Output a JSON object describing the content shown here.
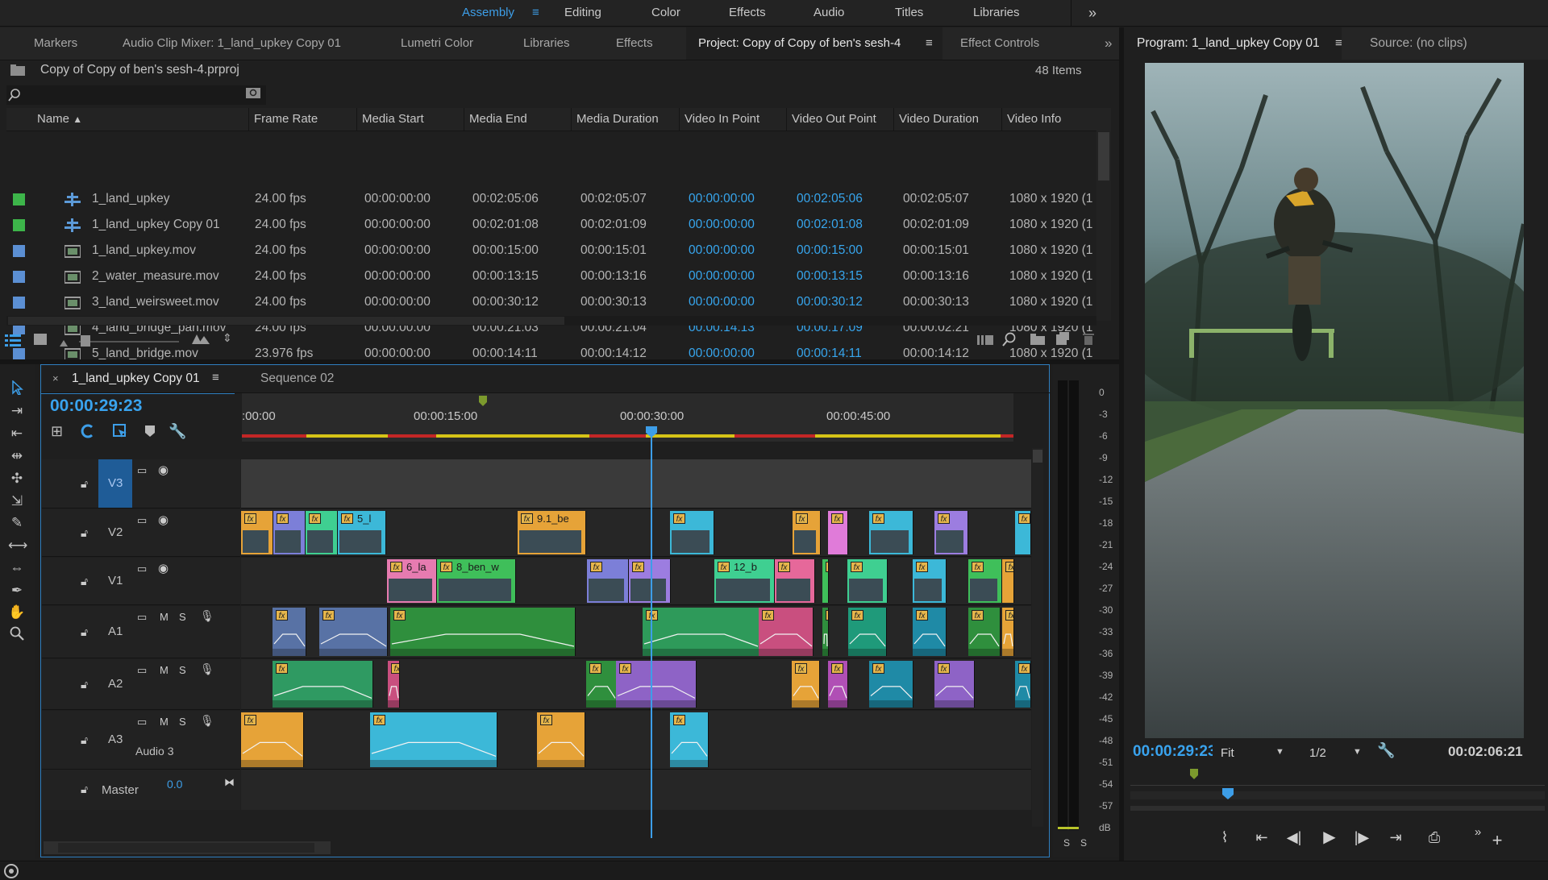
{
  "workspaces": {
    "items": [
      "Assembly",
      "Editing",
      "Color",
      "Effects",
      "Audio",
      "Titles",
      "Libraries"
    ],
    "active": "Assembly",
    "more": "»"
  },
  "panel_tabs": {
    "markers": "Markers",
    "audio_clip_mixer": "Audio Clip Mixer: 1_land_upkey Copy 01",
    "lumetri": "Lumetri Color",
    "libraries": "Libraries",
    "effects": "Effects",
    "project": "Project: Copy of Copy of ben's sesh-4",
    "effect_controls": "Effect Controls",
    "more": "»"
  },
  "project": {
    "filename": "Copy of Copy of ben's sesh-4.prproj",
    "item_count": "48 Items",
    "columns": [
      "Name",
      "Frame Rate",
      "Media Start",
      "Media End",
      "Media Duration",
      "Video In Point",
      "Video Out Point",
      "Video Duration",
      "Video Info"
    ],
    "rows": [
      {
        "color": "#3db54a",
        "kind": "sequence",
        "name": "1_land_upkey",
        "fps": "24.00 fps",
        "start": "00:00:00:00",
        "end": "00:02:05:06",
        "dur": "00:02:05:07",
        "vin": "00:00:00:00",
        "vout": "00:02:05:06",
        "vdur": "00:02:05:07",
        "info": "1080 x 1920 (1"
      },
      {
        "color": "#3db54a",
        "kind": "sequence",
        "name": "1_land_upkey Copy 01",
        "fps": "24.00 fps",
        "start": "00:00:00:00",
        "end": "00:02:01:08",
        "dur": "00:02:01:09",
        "vin": "00:00:00:00",
        "vout": "00:02:01:08",
        "vdur": "00:02:01:09",
        "info": "1080 x 1920 (1"
      },
      {
        "color": "#5b8fd3",
        "kind": "clip",
        "name": "1_land_upkey.mov",
        "fps": "24.00 fps",
        "start": "00:00:00:00",
        "end": "00:00:15:00",
        "dur": "00:00:15:01",
        "vin": "00:00:00:00",
        "vout": "00:00:15:00",
        "vdur": "00:00:15:01",
        "info": "1080 x 1920 (1"
      },
      {
        "color": "#5b8fd3",
        "kind": "clip",
        "name": "2_water_measure.mov",
        "fps": "24.00 fps",
        "start": "00:00:00:00",
        "end": "00:00:13:15",
        "dur": "00:00:13:16",
        "vin": "00:00:00:00",
        "vout": "00:00:13:15",
        "vdur": "00:00:13:16",
        "info": "1080 x 1920 (1"
      },
      {
        "color": "#5b8fd3",
        "kind": "clip",
        "name": "3_land_weirsweet.mov",
        "fps": "24.00 fps",
        "start": "00:00:00:00",
        "end": "00:00:30:12",
        "dur": "00:00:30:13",
        "vin": "00:00:00:00",
        "vout": "00:00:30:12",
        "vdur": "00:00:30:13",
        "info": "1080 x 1920 (1"
      },
      {
        "color": "#5b8fd3",
        "kind": "clip",
        "name": "4_land_bridge_pan.mov",
        "fps": "24.00 fps",
        "start": "00:00:00:00",
        "end": "00:00:21:03",
        "dur": "00:00:21:04",
        "vin": "00:00:14:13",
        "vout": "00:00:17:09",
        "vdur": "00:00:02:21",
        "info": "1080 x 1920 (1"
      },
      {
        "color": "#5b8fd3",
        "kind": "clip",
        "name": "5_land_bridge.mov",
        "fps": "23.976 fps",
        "start": "00:00:00:00",
        "end": "00:00:14:11",
        "dur": "00:00:14:12",
        "vin": "00:00:00:00",
        "vout": "00:00:14:11",
        "vdur": "00:00:14:12",
        "info": "1080 x 1920 (1"
      }
    ]
  },
  "timeline": {
    "tabs": [
      "1_land_upkey Copy 01",
      "Sequence 02"
    ],
    "timecode": "00:00:29:23",
    "ruler": [
      ":00:00",
      "00:00:15:00",
      "00:00:30:00",
      "00:00:45:00"
    ],
    "tracks": [
      {
        "id": "V3",
        "type": "video"
      },
      {
        "id": "V2",
        "type": "video"
      },
      {
        "id": "V1",
        "type": "video"
      },
      {
        "id": "A1",
        "type": "audio"
      },
      {
        "id": "A2",
        "type": "audio"
      },
      {
        "id": "A3",
        "type": "audio",
        "name": "Audio 3"
      }
    ],
    "track_buttons": {
      "mute": "M",
      "solo": "S"
    },
    "master_label": "Master",
    "master_value": "0.0",
    "clip_labels": {
      "v2a": "5_l",
      "v2b": "9.1_be",
      "v1a": "6_la",
      "v1b": "8_ben_w",
      "v1c": "12_b"
    },
    "fx": "fx"
  },
  "meter": {
    "scale": [
      "0",
      "-3",
      "-6",
      "-9",
      "-12",
      "-15",
      "-18",
      "-21",
      "-24",
      "-27",
      "-30",
      "-33",
      "-36",
      "-39",
      "-42",
      "-45",
      "-48",
      "-51",
      "-54",
      "-57",
      "dB"
    ],
    "solo": [
      "S",
      "S"
    ]
  },
  "program": {
    "title": "Program: 1_land_upkey Copy 01",
    "source": "Source: (no clips)",
    "timecode": "00:00:29:23",
    "fit": "Fit",
    "resolution": "1/2",
    "duration": "00:02:06:21"
  }
}
